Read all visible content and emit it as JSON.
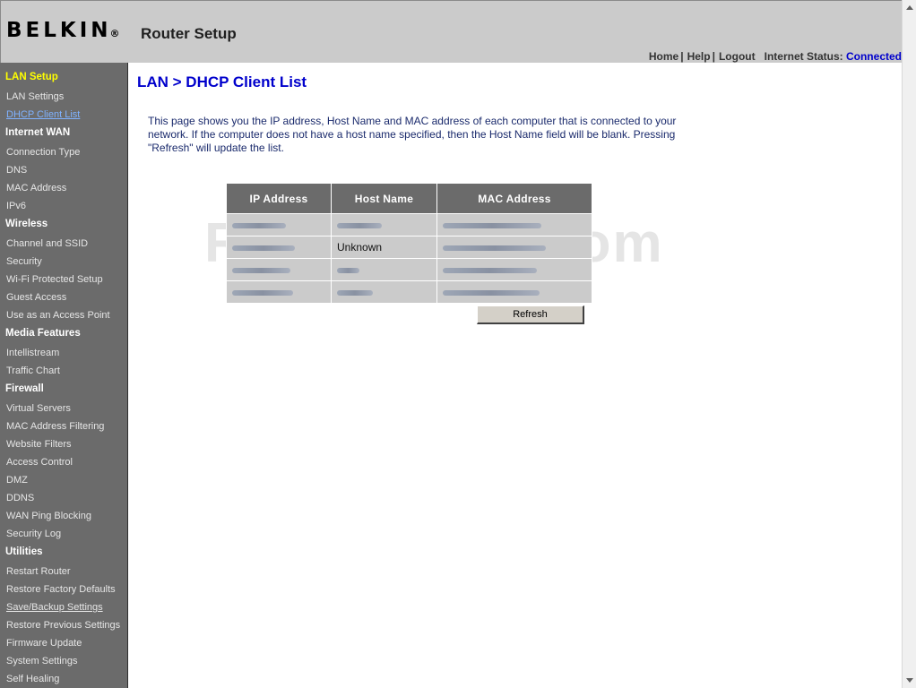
{
  "header": {
    "logo": "BELKIN",
    "logo_mark": "®",
    "title": "Router Setup",
    "nav": {
      "home": "Home",
      "help": "Help",
      "logout": "Logout",
      "sep": "|"
    },
    "status_label": "Internet Status:",
    "status_value": "Connected"
  },
  "sidebar": {
    "sections": [
      {
        "title": "LAN Setup",
        "items": [
          "LAN Settings",
          "DHCP Client List"
        ]
      },
      {
        "title": "Internet WAN",
        "items": [
          "Connection Type",
          "DNS",
          "MAC Address",
          "IPv6"
        ]
      },
      {
        "title": "Wireless",
        "items": [
          "Channel and SSID",
          "Security",
          "Wi-Fi Protected Setup",
          "Guest Access",
          "Use as an Access Point"
        ]
      },
      {
        "title": "Media Features",
        "items": [
          "Intellistream",
          "Traffic Chart"
        ]
      },
      {
        "title": "Firewall",
        "items": [
          "Virtual Servers",
          "MAC Address Filtering",
          "Website Filters",
          "Access Control",
          "DMZ",
          "DDNS",
          "WAN Ping Blocking",
          "Security Log"
        ]
      },
      {
        "title": "Utilities",
        "items": [
          "Restart Router",
          "Restore Factory Defaults",
          "Save/Backup Settings",
          "Restore Previous Settings",
          "Firmware Update",
          "System Settings",
          "Self Healing"
        ]
      }
    ]
  },
  "main": {
    "title": "LAN > DHCP Client List",
    "intro": "This page shows you the IP address, Host Name and MAC address of each computer that is connected to your network. If the computer does not have a host name specified, then the Host Name field will be blank. Pressing \"Refresh\" will update the list.",
    "table": {
      "headers": [
        "IP Address",
        "Host Name",
        "MAC Address"
      ],
      "rows": [
        {
          "host": ""
        },
        {
          "host": "Unknown"
        },
        {
          "host": ""
        },
        {
          "host": ""
        }
      ]
    },
    "refresh_label": "Refresh",
    "watermark": "RouterTech.com"
  },
  "colors": {
    "header_bg": "#cbcbcb",
    "sidebar_bg": "#6b6b6b",
    "active_section": "#ffff00",
    "title_blue": "#0000cc",
    "link_blue": "#7fb2ff",
    "table_header_bg": "#6b6b6b",
    "table_cell_bg": "#cbcbcb"
  }
}
